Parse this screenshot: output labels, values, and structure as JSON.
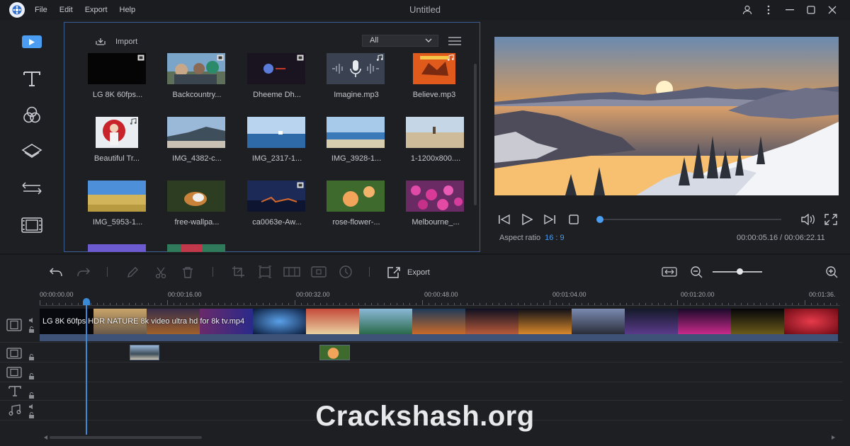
{
  "window": {
    "title": "Untitled",
    "menu": [
      "File",
      "Edit",
      "Export",
      "Help"
    ]
  },
  "library": {
    "import_label": "Import",
    "filter_value": "All",
    "items": [
      {
        "label": "LG 8K 60fps...",
        "kind": "video"
      },
      {
        "label": "Backcountry...",
        "kind": "video"
      },
      {
        "label": "Dheeme Dh...",
        "kind": "video"
      },
      {
        "label": "Imagine.mp3",
        "kind": "audio"
      },
      {
        "label": "Believe.mp3",
        "kind": "audio"
      },
      {
        "label": "Beautiful Tr...",
        "kind": "audio"
      },
      {
        "label": "IMG_4382-c...",
        "kind": "image"
      },
      {
        "label": "IMG_2317-1...",
        "kind": "image"
      },
      {
        "label": "IMG_3928-1...",
        "kind": "image"
      },
      {
        "label": "1-1200x800....",
        "kind": "image"
      },
      {
        "label": "IMG_5953-1...",
        "kind": "image"
      },
      {
        "label": "free-wallpa...",
        "kind": "image"
      },
      {
        "label": "ca0063e-Aw...",
        "kind": "video"
      },
      {
        "label": "rose-flower-...",
        "kind": "image"
      },
      {
        "label": "Melbourne_...",
        "kind": "image"
      }
    ]
  },
  "player": {
    "aspect_label": "Aspect ratio",
    "aspect_value": "16 : 9",
    "timecode": "00:00:05.16 / 00:06:22.11",
    "progress_fraction": 0.014
  },
  "timeline": {
    "export_label": "Export",
    "ruler": [
      "00:00:00.00",
      "00:00:16.00",
      "00:00:32.00",
      "00:00:48.00",
      "00:01:04.00",
      "00:01:20.00",
      "00:01:36."
    ],
    "main_clip_label": "LG 8K 60fps HDR NATURE 8k video ultra hd for 8k tv.mp4"
  },
  "watermark": "Crackshash.org",
  "colors": {
    "accent": "#4a9df0",
    "panel_border": "#3d5d95",
    "background": "#1e1f23"
  }
}
